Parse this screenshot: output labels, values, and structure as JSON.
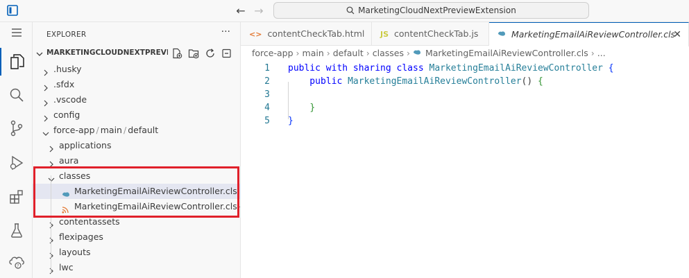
{
  "titlebar": {
    "search_text": "MarketingCloudNextPreviewExtension",
    "back_symbol": "←",
    "forward_symbol": "→"
  },
  "activitybar": {
    "items": [
      "explorer-icon",
      "search-icon",
      "source-control-icon",
      "run-debug-icon",
      "extensions-icon",
      "testing-icon",
      "salesforce-org-icon"
    ]
  },
  "sidebar": {
    "title": "EXPLORER",
    "more": "···",
    "section_name": "MARKETINGCLOUDNEXTPREVI...",
    "tree": [
      {
        "label": ".husky",
        "depth": 0,
        "kind": "folder",
        "expanded": false
      },
      {
        "label": ".sfdx",
        "depth": 0,
        "kind": "folder",
        "expanded": false
      },
      {
        "label": ".vscode",
        "depth": 0,
        "kind": "folder",
        "expanded": false
      },
      {
        "label": "config",
        "depth": 0,
        "kind": "folder",
        "expanded": false
      },
      {
        "label": "force-app / main / default",
        "depth": 0,
        "kind": "folder",
        "expanded": true
      },
      {
        "label": "applications",
        "depth": 1,
        "kind": "folder",
        "expanded": false
      },
      {
        "label": "aura",
        "depth": 1,
        "kind": "folder",
        "expanded": false
      },
      {
        "label": "classes",
        "depth": 1,
        "kind": "folder",
        "expanded": true
      },
      {
        "label": "MarketingEmailAiReviewController.cls",
        "depth": 2,
        "kind": "apex",
        "selected": true
      },
      {
        "label": "MarketingEmailAiReviewController.cls-met...",
        "depth": 2,
        "kind": "xml"
      },
      {
        "label": "contentassets",
        "depth": 1,
        "kind": "folder",
        "expanded": false
      },
      {
        "label": "flexipages",
        "depth": 1,
        "kind": "folder",
        "expanded": false
      },
      {
        "label": "layouts",
        "depth": 1,
        "kind": "folder",
        "expanded": false
      },
      {
        "label": "lwc",
        "depth": 1,
        "kind": "folder",
        "expanded": false
      }
    ]
  },
  "tabs": [
    {
      "label": "contentCheckTab.html",
      "icon": "<>",
      "icon_color": "#e37933",
      "active": false
    },
    {
      "label": "contentCheckTab.js",
      "icon": "JS",
      "icon_color": "#cbcb41",
      "active": false
    },
    {
      "label": "MarketingEmailAiReviewController.cls",
      "icon": "apex",
      "icon_color": "#519aba",
      "active": true
    }
  ],
  "tab_close": "✕",
  "breadcrumb": [
    "force-app",
    "main",
    "default",
    "classes",
    "MarketingEmailAiReviewController.cls",
    "..."
  ],
  "code": {
    "line_numbers": [
      "1",
      "2",
      "3",
      "4",
      "5"
    ],
    "lines": [
      [
        {
          "t": "public with sharing class ",
          "c": "kw"
        },
        {
          "t": "MarketingEmailAiReviewController",
          "c": "ty"
        },
        {
          "t": " ",
          "c": "pl"
        },
        {
          "t": "{",
          "c": "br1"
        }
      ],
      [
        {
          "t": "    public ",
          "c": "kw"
        },
        {
          "t": "MarketingEmailAiReviewController",
          "c": "ty"
        },
        {
          "t": "() ",
          "c": "pl"
        },
        {
          "t": "{",
          "c": "br2"
        }
      ],
      [],
      [
        {
          "t": "    ",
          "c": "pl"
        },
        {
          "t": "}",
          "c": "br2"
        }
      ],
      [
        {
          "t": "}",
          "c": "br1"
        }
      ]
    ]
  },
  "colors": {
    "accent": "#005fb8",
    "highlight_box": "#e0202a",
    "apex_icon": "#519aba",
    "xml_icon": "#e37933"
  }
}
